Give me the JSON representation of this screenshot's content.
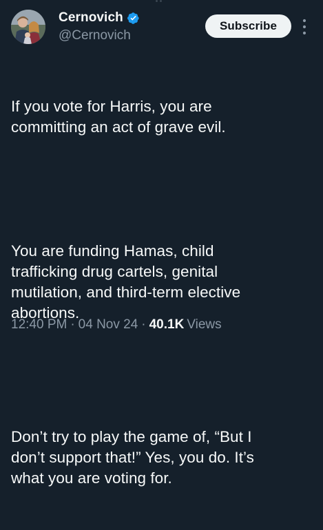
{
  "author": {
    "display_name": "Cernovich",
    "handle": "@Cernovich",
    "verified": true
  },
  "actions": {
    "subscribe_label": "Subscribe"
  },
  "post": {
    "paragraphs": [
      "If you vote for Harris, you are\ncommitting an act of grave evil.",
      "You are funding Hamas, child\ntrafficking drug cartels, genital\nmutilation, and third-term elective\nabortions.",
      "Don’t try to play the game of, “But I\ndon’t support that!” Yes, you do. It’s\nwhat you are voting for."
    ]
  },
  "meta": {
    "time": "12:40 PM",
    "separator": "·",
    "date": "04 Nov 24",
    "views_count": "40.1K",
    "views_label": "Views"
  },
  "colors": {
    "background": "#15202b",
    "text_primary": "#f7f9f9",
    "text_secondary": "#8b98a5",
    "verified_badge": "#1d9bf0",
    "subscribe_bg": "#eff3f4"
  }
}
